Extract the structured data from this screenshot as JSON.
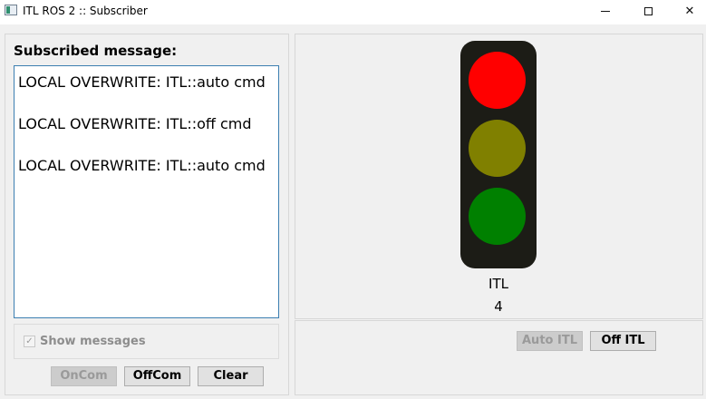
{
  "window": {
    "title": "ITL ROS 2 :: Subscriber",
    "close_glyph": "✕"
  },
  "subscriber": {
    "label": "Subscribed message:",
    "messages": [
      "LOCAL OVERWRITE: ITL::auto cmd",
      "LOCAL OVERWRITE: ITL::off cmd",
      "LOCAL OVERWRITE: ITL::auto cmd"
    ],
    "show_messages": {
      "label": "Show messages",
      "checked": true,
      "check_glyph": "✓"
    }
  },
  "buttons": {
    "oncom": "OnCom",
    "offcom": "OffCom",
    "clear": "Clear",
    "auto_itl": "Auto ITL",
    "off_itl": "Off ITL"
  },
  "traffic_light": {
    "name": "ITL",
    "count": "4",
    "colors": {
      "red": "#ff0000",
      "yellow": "#808000",
      "green": "#008000"
    }
  }
}
